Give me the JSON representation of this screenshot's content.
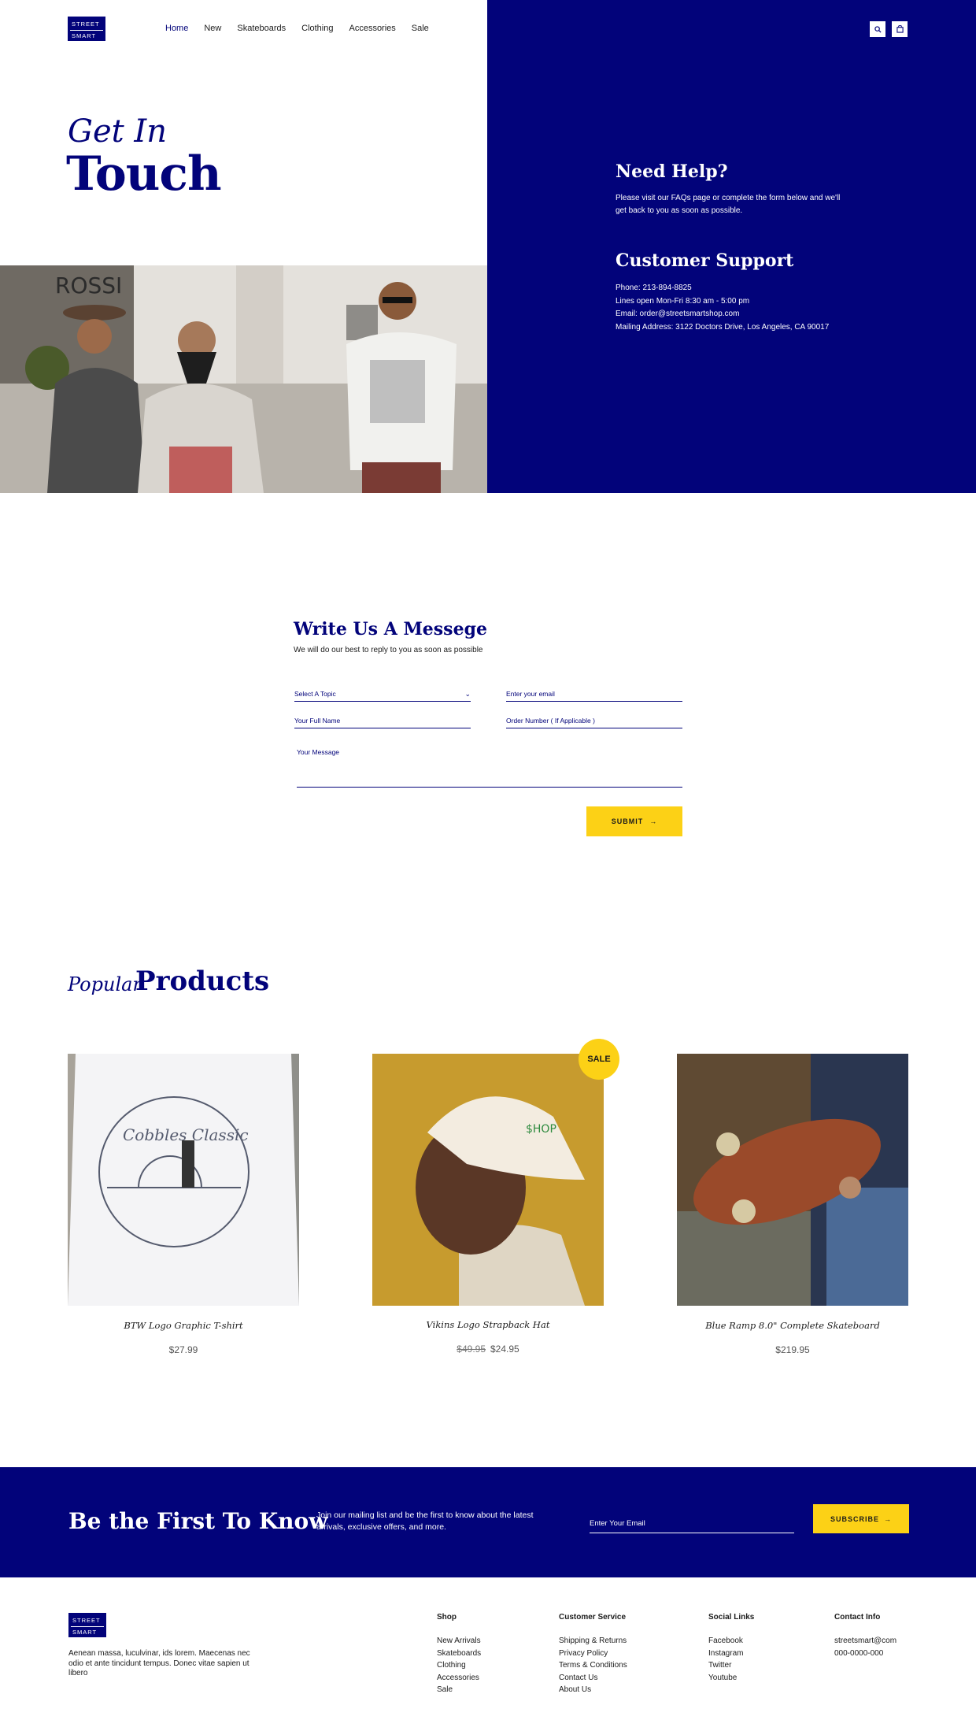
{
  "brand": {
    "logo_line1": "STREET",
    "logo_line2": "SMART"
  },
  "nav": {
    "items": [
      "Home",
      "New",
      "Skateboards",
      "Clothing",
      "Accessories",
      "Sale"
    ]
  },
  "header_icons": [
    "search-icon",
    "bag-icon"
  ],
  "hero": {
    "title_line1": "Get In",
    "title_line2": "Touch",
    "help_title": "Need Help?",
    "help_text": "Please visit our FAQs page or complete the form below and we'll get back to you as soon as possible.",
    "support_title": "Customer Support",
    "support_lines": [
      "Phone: 213-894-8825",
      "Lines open Mon-Fri 8:30 am - 5:00 pm",
      "Email: order@streetsmartshop.com",
      "Mailing Address: 3122  Doctors Drive, Los Angeles, CA 90017"
    ]
  },
  "form": {
    "title": "Write Us A Messege",
    "subtitle": "We will do our best to reply to you as soon as possible",
    "topic_placeholder": "Select A Topic",
    "email_placeholder": "Enter your email",
    "name_placeholder": "Your Full Name",
    "order_placeholder": "Order Number ( If Applicable )",
    "message_placeholder": "Your Message",
    "submit_label": "SUBMIT"
  },
  "products": {
    "heading_italic": "Popular",
    "heading_bold": "Products",
    "items": [
      {
        "name": "BTW Logo Graphic T-shirt",
        "price": "$27.99",
        "old_price": ""
      },
      {
        "name": "Vikins Logo Strapback Hat",
        "price": "$24.95",
        "old_price": "$49.95",
        "badge": "SALE"
      },
      {
        "name": "Blue Ramp 8.0\" Complete Skateboard",
        "price": "$219.95",
        "old_price": ""
      }
    ]
  },
  "newsletter": {
    "title": "Be the First To Know",
    "text": "Join our mailing list and be the first to know about the latest arrivals, exclusive offers, and more.",
    "email_placeholder": "Enter Your Email",
    "subscribe_label": "SUBSCRIBE"
  },
  "footer": {
    "about": "Aenean massa, luculvinar,  ids lorem. Maecenas nec odio et ante tincidunt tempus. Donec vitae sapien ut libero",
    "columns": [
      {
        "title": "Shop",
        "links": [
          "New Arrivals",
          "Skateboards",
          "Clothing",
          "Accessories",
          "Sale"
        ]
      },
      {
        "title": "Customer Service",
        "links": [
          "Shipping & Returns",
          "Privacy Policy",
          "Terms & Conditions",
          "Contact Us",
          "About Us"
        ]
      },
      {
        "title": "Social Links",
        "links": [
          "Facebook",
          "Instagram",
          "Twitter",
          "Youtube"
        ]
      },
      {
        "title": "Contact Info",
        "links": [
          "streetsmart@com",
          "000-0000-000"
        ]
      }
    ]
  },
  "colors": {
    "navy": "#02037a",
    "yellow": "#fcd116"
  }
}
